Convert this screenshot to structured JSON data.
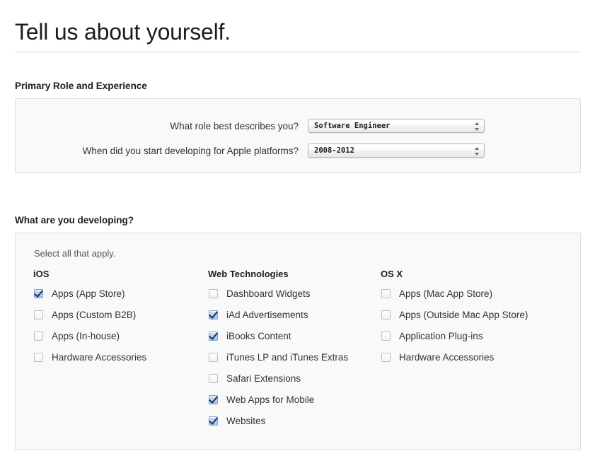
{
  "page": {
    "title": "Tell us about yourself."
  },
  "role_section": {
    "heading": "Primary Role and Experience",
    "fields": [
      {
        "label": "What role best describes you?",
        "value": "Software Engineer"
      },
      {
        "label": "When did you start developing for Apple platforms?",
        "value": "2008-2012"
      }
    ]
  },
  "developing_section": {
    "heading": "What are you developing?",
    "hint": "Select all that apply.",
    "columns": [
      {
        "title": "iOS",
        "options": [
          {
            "label": "Apps (App Store)",
            "checked": true
          },
          {
            "label": "Apps (Custom B2B)",
            "checked": false
          },
          {
            "label": "Apps (In-house)",
            "checked": false
          },
          {
            "label": "Hardware Accessories",
            "checked": false
          }
        ]
      },
      {
        "title": "Web Technologies",
        "options": [
          {
            "label": "Dashboard Widgets",
            "checked": false
          },
          {
            "label": "iAd Advertisements",
            "checked": true
          },
          {
            "label": "iBooks Content",
            "checked": true
          },
          {
            "label": "iTunes LP and iTunes Extras",
            "checked": false
          },
          {
            "label": "Safari Extensions",
            "checked": false
          },
          {
            "label": "Web Apps for Mobile",
            "checked": true
          },
          {
            "label": "Websites",
            "checked": true
          }
        ]
      },
      {
        "title": "OS X",
        "options": [
          {
            "label": "Apps (Mac App Store)",
            "checked": false
          },
          {
            "label": "Apps (Outside Mac App Store)",
            "checked": false
          },
          {
            "label": "Application Plug-ins",
            "checked": false
          },
          {
            "label": "Hardware Accessories",
            "checked": false
          }
        ]
      }
    ]
  },
  "colors": {
    "panel_bg": "#f8f9f9",
    "panel_border": "#e0e0e0",
    "checkbox_checked": "#a7c6e6",
    "rule": "#dcdcdc"
  }
}
